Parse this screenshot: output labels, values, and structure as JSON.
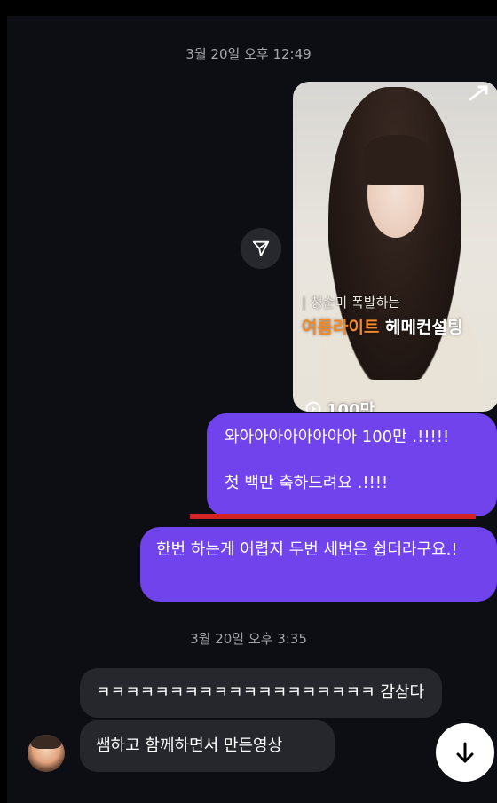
{
  "chat": {
    "timestamp_1": "3월 20일 오후 12:49",
    "timestamp_2": "3월 20일 오후 3:35",
    "shared_reel": {
      "caption_line1": "| 청순미 폭발하는",
      "caption_accent": "여름라이트",
      "caption_rest": " 헤메컨설팅",
      "views": "100만"
    },
    "messages_sent": [
      {
        "line1": "와아아아아아아아아 100만 .!!!!!",
        "line2": "첫 백만  축하드려요 .!!!!"
      },
      {
        "text": "한번 하는게 어렵지 두번 세번은 쉽더라구요.!"
      }
    ],
    "messages_received": [
      {
        "text": "ㅋㅋㅋㅋㅋㅋㅋㅋㅋㅋㅋㅋㅋㅋㅋㅋㅋㅋㅋ 감삼다"
      },
      {
        "text": "쌤하고 함께하면서 만든영상"
      }
    ]
  },
  "icons": {
    "share": "send-icon",
    "reel": "reels-icon",
    "views": "play-icon",
    "scroll": "arrow-down-icon"
  },
  "colors": {
    "sent_bubble": "#7143ec",
    "received_bubble": "#25272d",
    "background": "#0c0e13",
    "accent_caption": "#f08a2a",
    "underline": "#d22424"
  }
}
